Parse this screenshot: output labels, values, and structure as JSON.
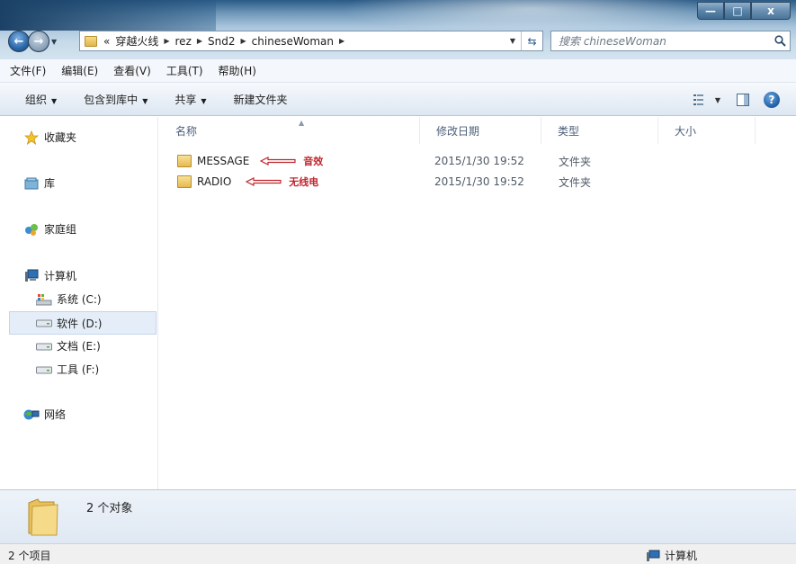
{
  "window": {
    "buttons": {
      "minimize": "—",
      "maximize": "□",
      "close": "x"
    }
  },
  "address_bar": {
    "overflow": "«",
    "crumbs": [
      "穿越火线",
      "rez",
      "Snd2",
      "chineseWoman"
    ]
  },
  "search": {
    "placeholder": "搜索 chineseWoman"
  },
  "menu": [
    "文件(F)",
    "编辑(E)",
    "查看(V)",
    "工具(T)",
    "帮助(H)"
  ],
  "commands": [
    {
      "label": "组织",
      "has_dropdown": true
    },
    {
      "label": "包含到库中",
      "has_dropdown": true
    },
    {
      "label": "共享",
      "has_dropdown": true
    },
    {
      "label": "新建文件夹",
      "has_dropdown": false
    }
  ],
  "nav_pane": {
    "favorites": "收藏夹",
    "libraries": "库",
    "homegroup": "家庭组",
    "computer": "计算机",
    "drives": [
      {
        "label": "系统 (C:)",
        "icon": "system-drive-icon",
        "selected": false
      },
      {
        "label": "软件 (D:)",
        "icon": "drive-icon",
        "selected": true
      },
      {
        "label": "文档 (E:)",
        "icon": "drive-icon",
        "selected": false
      },
      {
        "label": "工具 (F:)",
        "icon": "drive-icon",
        "selected": false
      }
    ],
    "network": "网络"
  },
  "columns": [
    "名称",
    "修改日期",
    "类型",
    "大小"
  ],
  "files": [
    {
      "name": "MESSAGE",
      "modified": "2015/1/30 19:52",
      "type": "文件夹",
      "annotation": "音效"
    },
    {
      "name": "RADIO",
      "modified": "2015/1/30 19:52",
      "type": "文件夹",
      "annotation": "无线电"
    }
  ],
  "details": {
    "count": "2 个对象"
  },
  "status": {
    "items": "2 个项目",
    "location": "计算机"
  },
  "colors": {
    "annotation": "#c0262d",
    "selection": "#e5eef8",
    "chrome": "#6f97b9"
  }
}
